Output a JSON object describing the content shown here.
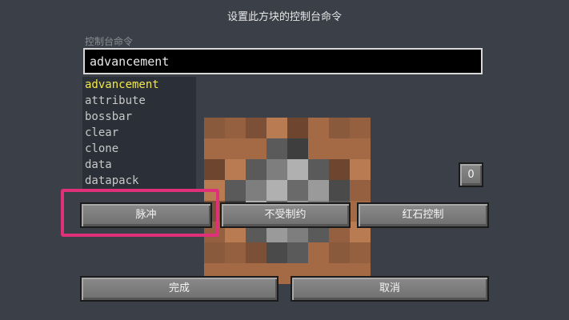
{
  "dialog": {
    "title": "设置此方块的控制台命令",
    "field_label": "控制台命令",
    "command_value": "advancement"
  },
  "suggestions": [
    {
      "text": "advancement",
      "selected": true
    },
    {
      "text": "attribute",
      "selected": false
    },
    {
      "text": "bossbar",
      "selected": false
    },
    {
      "text": "clear",
      "selected": false
    },
    {
      "text": "clone",
      "selected": false
    },
    {
      "text": "data",
      "selected": false
    },
    {
      "text": "datapack",
      "selected": false
    }
  ],
  "buttons": {
    "mode": "脉冲",
    "conditional": "不受制约",
    "redstone": "红石控制",
    "output": "0",
    "done": "完成",
    "cancel": "取消"
  },
  "colors": {
    "highlight": "#e0307a",
    "selected_suggestion": "#f2e84a"
  }
}
